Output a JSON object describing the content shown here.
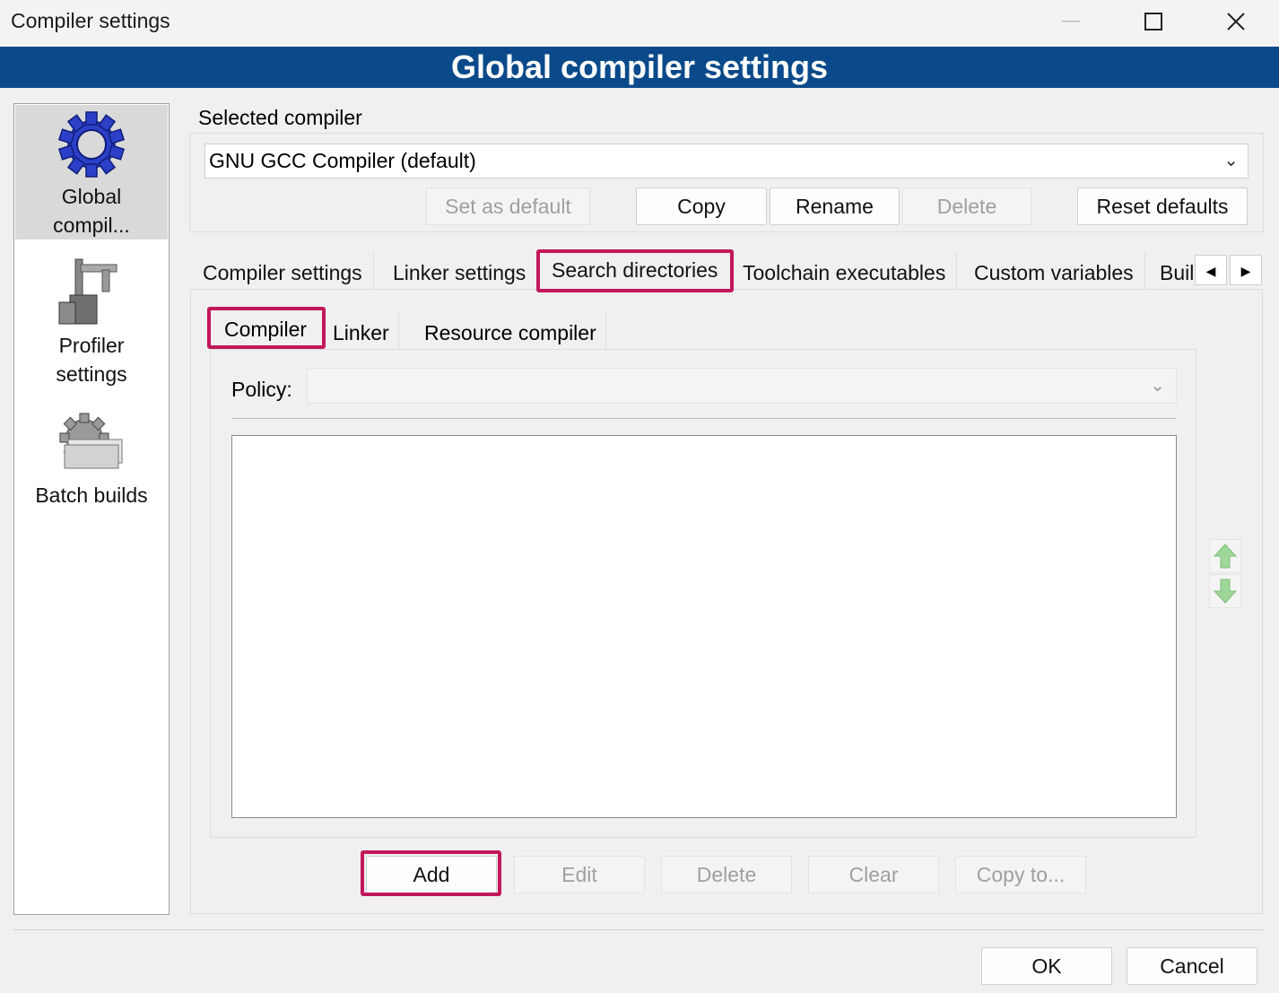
{
  "window": {
    "title": "Compiler settings"
  },
  "banner": {
    "title": "Global compiler settings"
  },
  "left_panel": {
    "items": [
      {
        "label": "Global compil...",
        "icon": "gear-icon",
        "selected": true
      },
      {
        "label": "Profiler settings",
        "icon": "caliper-icon",
        "selected": false
      },
      {
        "label": "Batch builds",
        "icon": "batch-gear-icon",
        "selected": false
      }
    ],
    "label_lines": {
      "global_1": "Global",
      "global_2": "compil...",
      "profiler_1": "Profiler",
      "profiler_2": "settings",
      "batch": "Batch builds"
    }
  },
  "selected_compiler": {
    "group_label": "Selected compiler",
    "value": "GNU GCC Compiler (default)",
    "buttons": {
      "set_default": "Set as default",
      "copy": "Copy",
      "rename": "Rename",
      "delete": "Delete",
      "reset": "Reset defaults"
    }
  },
  "tabs": {
    "compiler_settings": "Compiler settings",
    "linker_settings": "Linker settings",
    "search_directories": "Search directories",
    "toolchain": "Toolchain executables",
    "custom_vars": "Custom variables",
    "build_truncated": "Buil",
    "active": "Search directories"
  },
  "subtabs": {
    "compiler": "Compiler",
    "linker": "Linker",
    "resource": "Resource compiler",
    "active": "Compiler"
  },
  "policy": {
    "label": "Policy:",
    "value": ""
  },
  "directory_list": [],
  "list_buttons": {
    "add": "Add",
    "edit": "Edit",
    "delete": "Delete",
    "clear": "Clear",
    "copy_to": "Copy to..."
  },
  "dialog_buttons": {
    "ok": "OK",
    "cancel": "Cancel"
  },
  "colors": {
    "banner": "#0a4a8a",
    "highlight": "#c2185b",
    "arrow_green": "#9fd69a"
  }
}
